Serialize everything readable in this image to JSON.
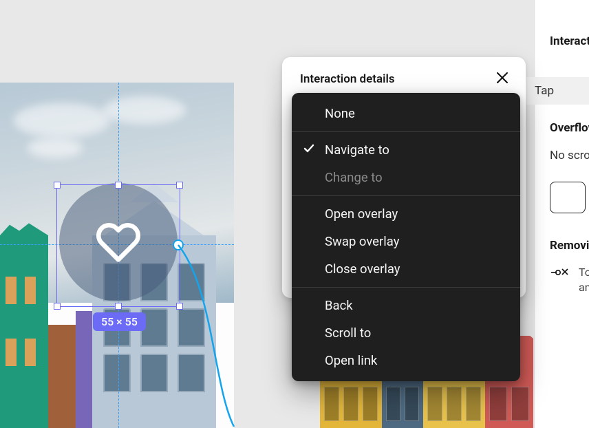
{
  "popover": {
    "title": "Interaction details"
  },
  "dropdown": {
    "selected": "Navigate to",
    "items": [
      {
        "label": "None"
      },
      {
        "sep": true
      },
      {
        "label": "Navigate to",
        "checked": true
      },
      {
        "label": "Change to",
        "disabled": true
      },
      {
        "sep": true
      },
      {
        "label": "Open overlay"
      },
      {
        "label": "Swap overlay"
      },
      {
        "label": "Close overlay"
      },
      {
        "sep": true
      },
      {
        "label": "Back"
      },
      {
        "label": "Scroll to"
      },
      {
        "label": "Open link"
      }
    ]
  },
  "sidebar": {
    "interactions_header": "Interactions",
    "trigger": "Tap",
    "overflow_header": "Overflow",
    "overflow_value": "No scrolling",
    "remove_header": "Removing a connection",
    "remove_text_line1": "To delete a connection, click",
    "remove_text_line2": "and drag either end point."
  },
  "selection": {
    "dimensions": "55 × 55"
  },
  "icons": {
    "heart": "heart-icon",
    "close": "close-icon",
    "check": "check-icon",
    "remove_connection": "remove-connection-icon"
  }
}
